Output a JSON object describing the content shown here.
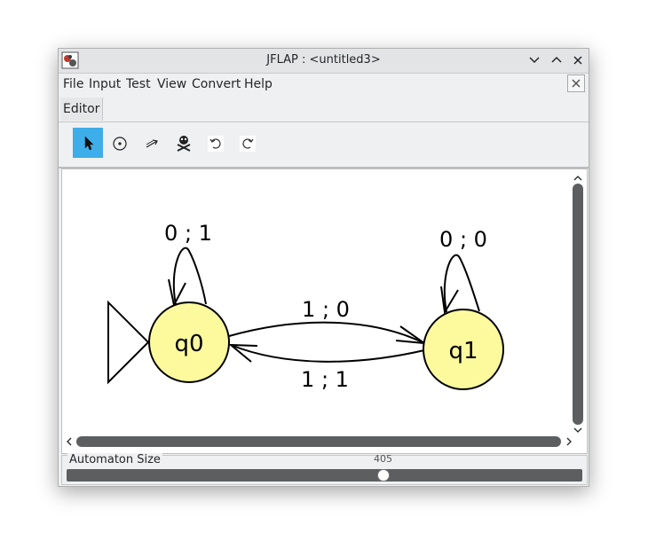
{
  "window": {
    "title": "JFLAP : <untitled3>"
  },
  "menu": [
    "File",
    "Input",
    "Test",
    "View",
    "Convert",
    "Help"
  ],
  "tabs": [
    {
      "label": "Editor"
    }
  ],
  "toolbar": {
    "tools": [
      "pointer-tool",
      "state-tool",
      "transition-tool",
      "delete-tool",
      "undo-tool",
      "redo-tool"
    ],
    "active_tool": "pointer-tool"
  },
  "automaton": {
    "states": [
      {
        "id": "q0",
        "label": "q0",
        "initial": true
      },
      {
        "id": "q1",
        "label": "q1",
        "initial": false
      }
    ],
    "transitions": [
      {
        "from": "q0",
        "to": "q0",
        "label": "0 ; 1"
      },
      {
        "from": "q1",
        "to": "q1",
        "label": "0 ; 0"
      },
      {
        "from": "q0",
        "to": "q1",
        "label": "1 ; 0"
      },
      {
        "from": "q1",
        "to": "q0",
        "label": "1 ; 1"
      }
    ],
    "state_fill": "#fdfa9e"
  },
  "size_slider": {
    "label": "Automaton Size",
    "value": "405"
  },
  "colors": {
    "accent": "#3daee9",
    "scrollbar": "#5c5e60"
  }
}
